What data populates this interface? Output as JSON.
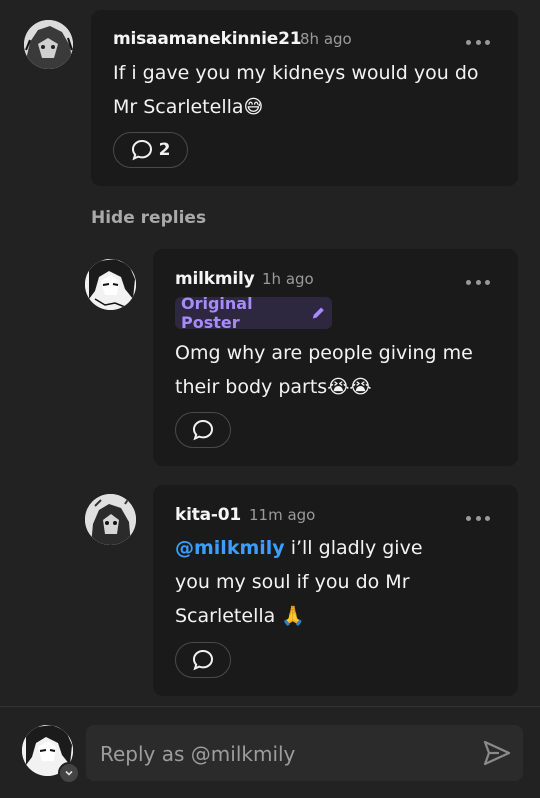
{
  "comments": [
    {
      "username": "misaamanekinnie21",
      "time": "8h ago",
      "text": "If i gave you my kidneys would you do Mr Scarletella",
      "emoji": "😅",
      "reply_count": "2",
      "avatar_icon": "anime-avatar-icon"
    },
    {
      "username": "milkmily",
      "time": "1h ago",
      "badge": "Original Poster",
      "text": "Omg why are people giving me their body parts",
      "emoji": "😭😭",
      "avatar_icon": "anime-avatar-icon"
    },
    {
      "username": "kita-01",
      "time": "11m ago",
      "mention": "@milkmily",
      "text": " i’ll gladly give you my soul if you do Mr Scarletella ",
      "emoji": "🙏",
      "avatar_icon": "anime-avatar-icon"
    }
  ],
  "thread": {
    "hide_replies_label": "Hide replies"
  },
  "composer": {
    "placeholder": "Reply as @milkmily"
  },
  "colors": {
    "background": "#222222",
    "card": "#1a1a1a",
    "mention": "#3b9eff",
    "badge_text": "#a78bfa",
    "badge_bg": "#2e2740"
  }
}
